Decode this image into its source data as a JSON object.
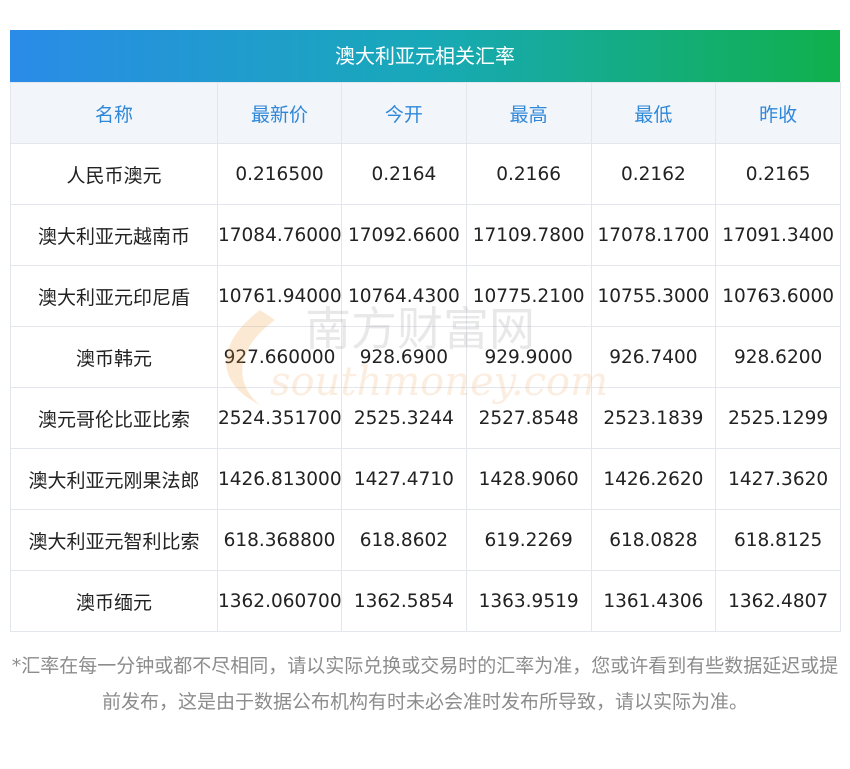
{
  "title": "澳大利亚元相关汇率",
  "headers": [
    "名称",
    "最新价",
    "今开",
    "最高",
    "最低",
    "昨收"
  ],
  "rows": [
    [
      "人民币澳元",
      "0.216500",
      "0.2164",
      "0.2166",
      "0.2162",
      "0.2165"
    ],
    [
      "澳大利亚元越南币",
      "17084.760000",
      "17092.6600",
      "17109.7800",
      "17078.1700",
      "17091.3400"
    ],
    [
      "澳大利亚元印尼盾",
      "10761.940000",
      "10764.4300",
      "10775.2100",
      "10755.3000",
      "10763.6000"
    ],
    [
      "澳币韩元",
      "927.660000",
      "928.6900",
      "929.9000",
      "926.7400",
      "928.6200"
    ],
    [
      "澳元哥伦比亚比索",
      "2524.351700",
      "2525.3244",
      "2527.8548",
      "2523.1839",
      "2525.1299"
    ],
    [
      "澳大利亚元刚果法郎",
      "1426.813000",
      "1427.4710",
      "1428.9060",
      "1426.2620",
      "1427.3620"
    ],
    [
      "澳大利亚元智利比索",
      "618.368800",
      "618.8602",
      "619.2269",
      "618.0828",
      "618.8125"
    ],
    [
      "澳币缅元",
      "1362.060700",
      "1362.5854",
      "1363.9519",
      "1361.4306",
      "1362.4807"
    ]
  ],
  "note": "*汇率在每一分钟或都不尽相同，请以实际兑换或交易时的汇率为准，您或许看到有些数据延迟或提前发布，这是由于数据公布机构有时未必会准时发布所导致，请以实际为准。",
  "watermark": {
    "cn": "南方财富网",
    "en": "southmoney.com"
  },
  "colors": {
    "title_gradient_start": "#2a8be8",
    "title_gradient_end": "#10b04c",
    "header_text": "#2f87d8",
    "header_bg": "#f2f6fb"
  }
}
